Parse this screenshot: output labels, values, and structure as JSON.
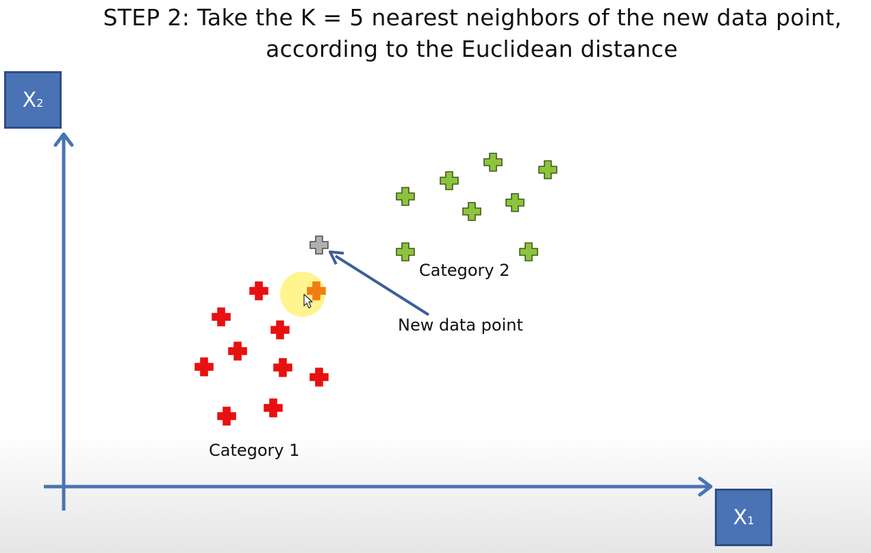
{
  "title": {
    "step": "STEP 2",
    "rest_line1": ": Take the K = 5 nearest neighbors of the new data point,",
    "line2": "according to the Euclidean distance"
  },
  "axes": {
    "y_label_main": "X",
    "y_label_sub": "2",
    "x_label_main": "X",
    "x_label_sub": "1"
  },
  "labels": {
    "category1": "Category 1",
    "category2": "Category 2",
    "new_point": "New data point"
  },
  "colors": {
    "axis": "#4a73b5",
    "category1": "#e81010",
    "category2": "#8cc43c",
    "new_point": "#b0b0b0",
    "highlight": "#fff27a",
    "highlighted_neighbor": "#f07d10"
  },
  "chart_data": {
    "type": "scatter",
    "grid": false,
    "series": [
      {
        "name": "Category 1",
        "color": "#e81010",
        "points": [
          [
            378,
            425
          ],
          [
            323,
            463
          ],
          [
            409,
            482
          ],
          [
            347,
            513
          ],
          [
            298,
            536
          ],
          [
            413,
            537
          ],
          [
            466,
            551
          ],
          [
            399,
            596
          ],
          [
            331,
            608
          ]
        ]
      },
      {
        "name": "Category 2",
        "color": "#8cc43c",
        "points": [
          [
            720,
            237
          ],
          [
            800,
            248
          ],
          [
            656,
            264
          ],
          [
            592,
            287
          ],
          [
            752,
            296
          ],
          [
            689,
            309
          ],
          [
            592,
            368
          ],
          [
            772,
            368
          ]
        ]
      },
      {
        "name": "New data point",
        "color": "#b0b0b0",
        "points": [
          [
            466,
            358
          ]
        ]
      }
    ],
    "highlighted": [
      [
        462,
        425
      ]
    ]
  }
}
